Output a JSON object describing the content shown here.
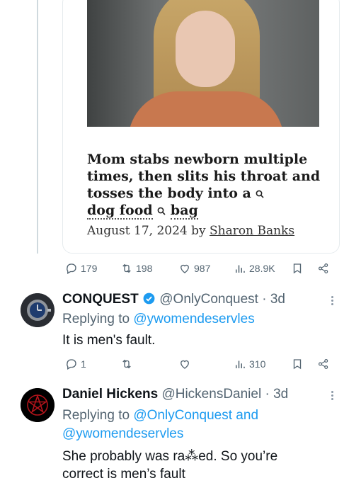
{
  "article": {
    "headline_parts": [
      "Mom stabs newborn multiple times, then slits his throat and tosses the body into a",
      "dog food",
      "bag"
    ],
    "date": "August 17, 2024 by ",
    "author": "Sharon Banks"
  },
  "main_tweet_stats": {
    "replies": "179",
    "retweets": "198",
    "likes": "987",
    "views": "28.9K"
  },
  "reply1": {
    "name": "CONQUEST",
    "handle": "@OnlyConquest",
    "time": "3d",
    "replying_prefix": "Replying to ",
    "replying_to": "@ywomendeservles",
    "text": "It is men's fault.",
    "replies": "1",
    "retweets": "",
    "likes": "",
    "views": "310"
  },
  "reply2": {
    "name": "Daniel Hickens",
    "handle": "@HickensDaniel",
    "time": "3d",
    "replying_prefix": "Replying to ",
    "replying_to": "@OnlyConquest and @ywomendeservles",
    "text": "She probably was ra⁂ed. So you’re correct is men’s fault"
  },
  "colors": {
    "link": "#1d9bf0",
    "muted": "#536471",
    "verified": "#1d9bf0"
  }
}
